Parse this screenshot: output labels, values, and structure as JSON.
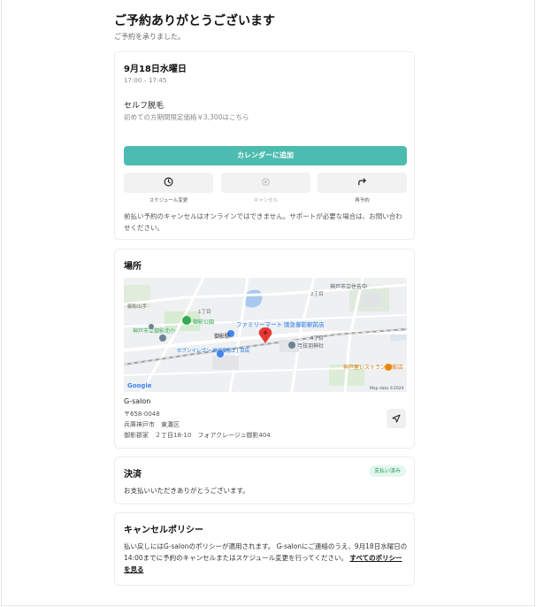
{
  "header": {
    "title": "ご予約ありがとうございます",
    "subtitle": "ご予約を承りました。"
  },
  "booking": {
    "date": "9月18日水曜日",
    "time": "17:00 – 17:45",
    "menu_name": "セルフ脱毛",
    "menu_desc": "初めての方期間限定価格￥3,300はこちら",
    "calendar_button": "カレンダーに追加",
    "actions": [
      {
        "label": "スケジュール変更",
        "icon": "clock-icon",
        "enabled": true
      },
      {
        "label": "キャンセル",
        "icon": "cancel-icon",
        "enabled": false
      },
      {
        "label": "再予約",
        "icon": "rebook-icon",
        "enabled": true
      }
    ],
    "note": "前払い予約のキャンセルはオンラインではできません。サポートが必要な場合は、お問い合わせください。"
  },
  "location": {
    "title": "場所",
    "salon_name": "G-salon",
    "postal": "〒658-0048",
    "city": "兵庫神戸市　東灘区",
    "street": "御影郡家　２丁目18-10　フォアクレージュ御影404",
    "map": {
      "labels": [
        "神戸市立住吉中",
        "神戸市立御影北小",
        "御影公園",
        "ファミリーマート 阪急御影駅前店",
        "御影駅",
        "弓弦羽神社",
        "セブンイレブン 神戸御影2丁目店",
        "神戸屋レストラン 御影店",
        "御影山手",
        "1丁目",
        "2丁目",
        "3丁目",
        "Google",
        "Map data ©2024"
      ]
    }
  },
  "payment": {
    "title": "決済",
    "badge": "支払い済み",
    "text": "お支払いいただきありがとうございます。"
  },
  "cancel_policy": {
    "title": "キャンセルポリシー",
    "text": "払い戻しにはG-salonのポリシーが適用されます。 G-salonにご連絡のうえ、9月18日水曜日の14:00までに予約のキャンセルまたはスケジュール変更を行ってください。",
    "link": "すべてのポリシーを見る"
  },
  "colors": {
    "accent": "#4dbcb0",
    "paid_bg": "#e4f7ee",
    "paid_text": "#1d9a5b",
    "pin": "#e53935"
  }
}
